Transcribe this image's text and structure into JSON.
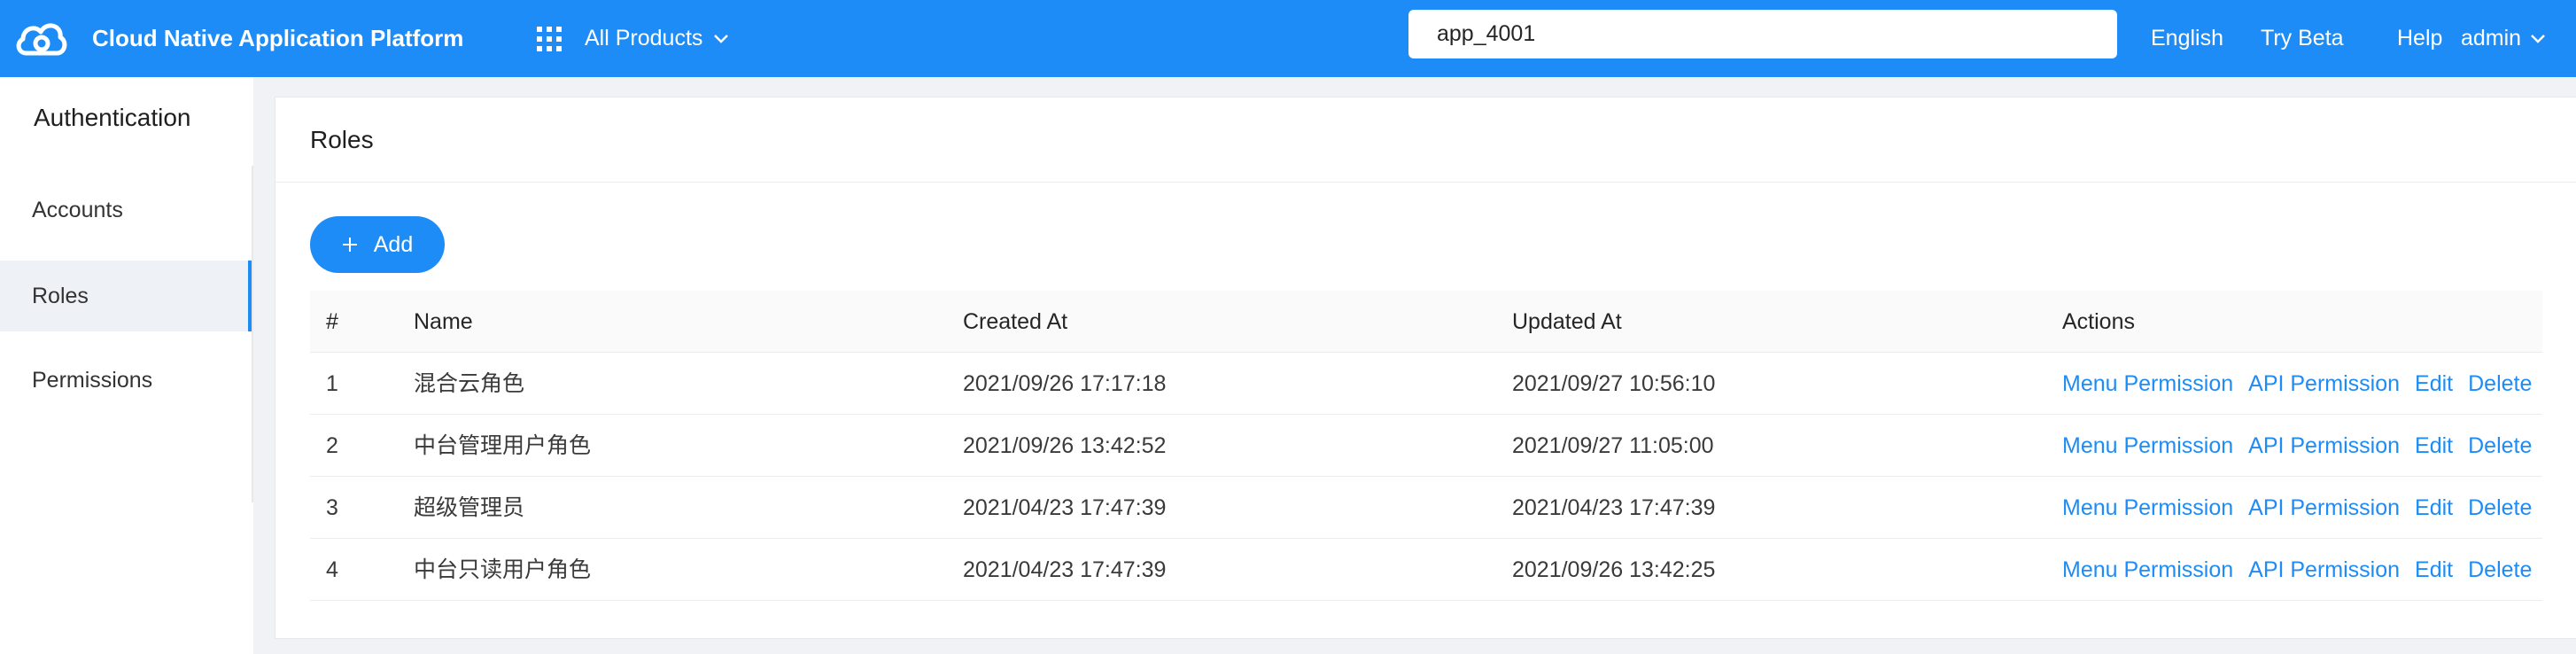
{
  "header": {
    "app_title": "Cloud Native Application Platform",
    "all_products_label": "All Products",
    "search_value": "app_4001",
    "nav": {
      "english": "English",
      "try_beta": "Try Beta",
      "help": "Help",
      "admin": "admin"
    }
  },
  "sidebar": {
    "title": "Authentication",
    "items": [
      {
        "label": "Accounts",
        "active": false
      },
      {
        "label": "Roles",
        "active": true
      },
      {
        "label": "Permissions",
        "active": false
      }
    ]
  },
  "main": {
    "title": "Roles",
    "add_button_label": "Add",
    "table": {
      "columns": [
        "#",
        "Name",
        "Created At",
        "Updated At",
        "Actions"
      ],
      "rows": [
        {
          "index": "1",
          "name": "混合云角色",
          "created_at": "2021/09/26 17:17:18",
          "updated_at": "2021/09/27 10:56:10"
        },
        {
          "index": "2",
          "name": "中台管理用户角色",
          "created_at": "2021/09/26 13:42:52",
          "updated_at": "2021/09/27 11:05:00"
        },
        {
          "index": "3",
          "name": "超级管理员",
          "created_at": "2021/04/23 17:47:39",
          "updated_at": "2021/04/23 17:47:39"
        },
        {
          "index": "4",
          "name": "中台只读用户角色",
          "created_at": "2021/04/23 17:47:39",
          "updated_at": "2021/09/26 13:42:25"
        }
      ],
      "actions": [
        "Menu Permission",
        "API Permission",
        "Edit",
        "Delete"
      ]
    }
  },
  "colors": {
    "brand": "#1e8cf6",
    "background": "#f0f2f5",
    "active_item_bg": "#eef2f7"
  },
  "icons": {
    "logo": "cloud-logo-icon",
    "products": "grid-icon",
    "dropdown": "chevron-down-icon",
    "add": "plus-icon"
  }
}
